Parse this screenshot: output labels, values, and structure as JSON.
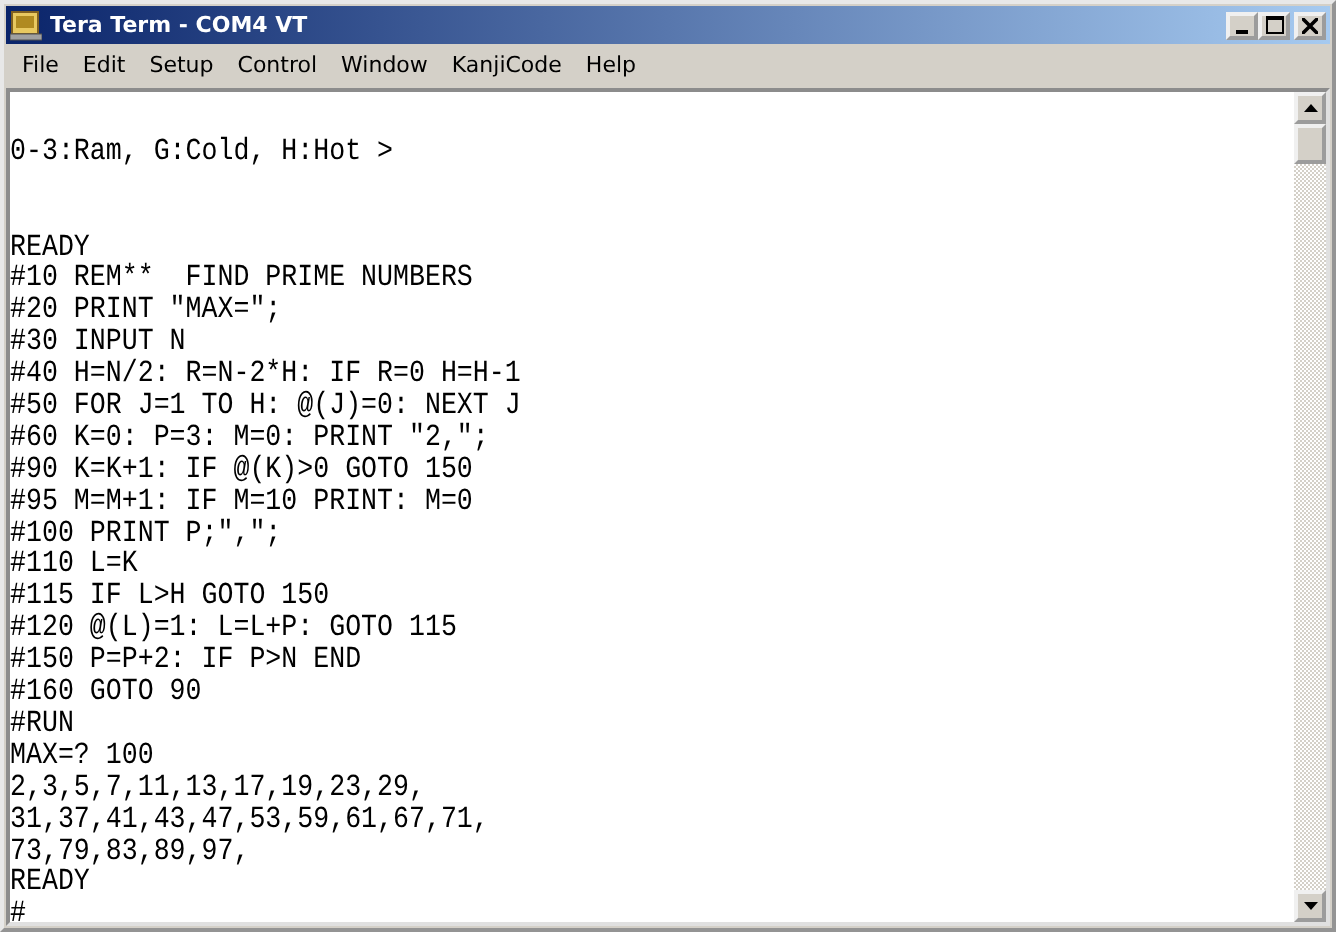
{
  "window": {
    "title": "Tera Term - COM4 VT"
  },
  "menu": [
    "File",
    "Edit",
    "Setup",
    "Control",
    "Window",
    "KanjiCode",
    "Help"
  ],
  "terminal": {
    "prompt_line": "0-3:Ram, G:Cold, H:Hot >",
    "lines": [
      "READY",
      "#10 REM**  FIND PRIME NUMBERS",
      "#20 PRINT \"MAX=\";",
      "#30 INPUT N",
      "#40 H=N/2: R=N-2*H: IF R=0 H=H-1",
      "#50 FOR J=1 TO H: @(J)=0: NEXT J",
      "#60 K=0: P=3: M=0: PRINT \"2,\";",
      "#90 K=K+1: IF @(K)>0 GOTO 150",
      "#95 M=M+1: IF M=10 PRINT: M=0",
      "#100 PRINT P;\",\";",
      "#110 L=K",
      "#115 IF L>H GOTO 150",
      "#120 @(L)=1: L=L+P: GOTO 115",
      "#150 P=P+2: IF P>N END",
      "#160 GOTO 90",
      "#RUN",
      "MAX=? 100",
      "2,3,5,7,11,13,17,19,23,29,",
      "31,37,41,43,47,53,59,61,67,71,",
      "73,79,83,89,97,",
      "READY",
      "#"
    ]
  }
}
